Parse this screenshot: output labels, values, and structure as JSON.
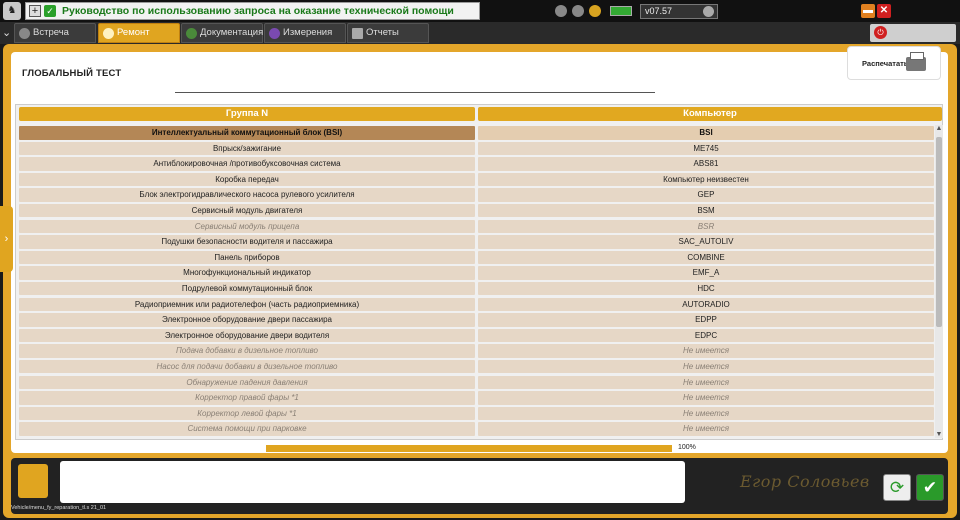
{
  "titlebar": {
    "help_text": "Руководство по использованию запроса на оказание технической помощи",
    "version": "v07.57"
  },
  "tabs": [
    {
      "label": "Встреча",
      "icon": "meeting-icon"
    },
    {
      "label": "Ремонт",
      "icon": "repair-icon",
      "active": true
    },
    {
      "label": "Документация",
      "icon": "documentation-icon"
    },
    {
      "label": "Измерения",
      "icon": "measurement-icon"
    },
    {
      "label": "Отчеты",
      "icon": "reports-icon"
    }
  ],
  "page": {
    "title": "ГЛОБАЛЬНЫЙ ТЕСТ",
    "print_label": "Распечатать"
  },
  "table": {
    "columns": [
      "Группа N",
      "Компьютер"
    ],
    "rows": [
      {
        "group": "Интеллектуальный коммутационный блок (BSI)",
        "computer": "BSI",
        "selected": true
      },
      {
        "group": "Впрыск/зажигание",
        "computer": "ME745"
      },
      {
        "group": "Антиблокировочная /противобуксовочная система",
        "computer": "ABS81"
      },
      {
        "group": "Коробка передач",
        "computer": "Компьютер неизвестен"
      },
      {
        "group": "Блок электрогидравлического насоса рулевого усилителя",
        "computer": "GEP"
      },
      {
        "group": "Сервисный модуль двигателя",
        "computer": "BSM"
      },
      {
        "group": "Сервисный модуль прицепа",
        "computer": "BSR",
        "unavailable": true
      },
      {
        "group": "Подушки безопасности водителя и пассажира",
        "computer": "SAC_AUTOLIV"
      },
      {
        "group": "Панель приборов",
        "computer": "COMBINE"
      },
      {
        "group": "Многофункциональный индикатор",
        "computer": "EMF_A"
      },
      {
        "group": "Подрулевой коммутационный блок",
        "computer": "HDC"
      },
      {
        "group": "Радиоприемник или радиотелефон (часть радиоприемника)",
        "computer": "AUTORADIO"
      },
      {
        "group": "Электронное оборудование двери пассажира",
        "computer": "EDPP"
      },
      {
        "group": "Электронное оборудование двери водителя",
        "computer": "EDPC"
      },
      {
        "group": "Подача добавки в дизельное топливо",
        "computer": "Не имеется",
        "unavailable": true
      },
      {
        "group": "Насос для подачи добавки в дизельное топливо",
        "computer": "Не имеется",
        "unavailable": true
      },
      {
        "group": "Обнаружение падения давления",
        "computer": "Не имеется",
        "unavailable": true
      },
      {
        "group": "Корректор правой фары *1",
        "computer": "Не имеется",
        "unavailable": true
      },
      {
        "group": "Корректор левой фары *1",
        "computer": "Не имеется",
        "unavailable": true
      },
      {
        "group": "Система помощи при парковке",
        "computer": "Не имеется",
        "unavailable": true
      }
    ]
  },
  "progress": {
    "value": 1.0,
    "label": "100%"
  },
  "signature": "Егор Соловьев",
  "footer": "Vehicle/menu_fy_reparation_tl.s 21_01",
  "colors": {
    "accent": "#e0a520",
    "row_bg": "#e6d7c6",
    "selected_row": "#b48756"
  }
}
